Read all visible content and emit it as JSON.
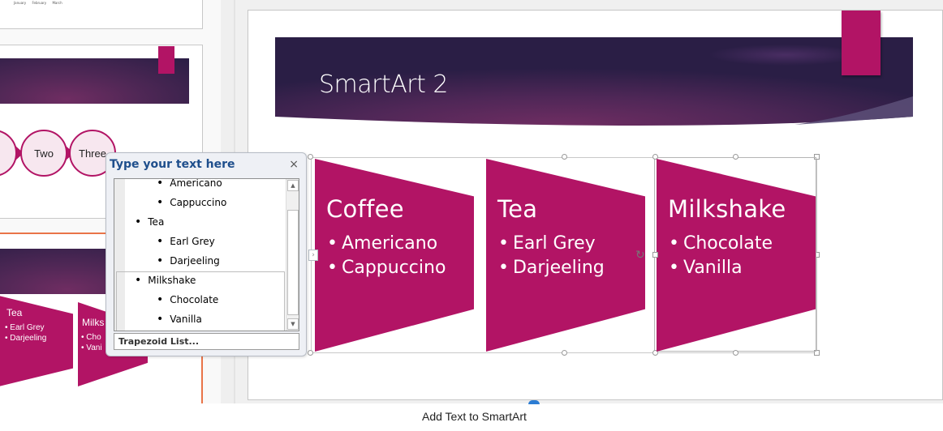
{
  "thumbnails": {
    "slide_prev_legend": [
      "January",
      "February",
      "March"
    ],
    "slide_process": {
      "steps": [
        "Two",
        "Three"
      ]
    },
    "slide_trapezoid": {
      "items": [
        {
          "title": "Tea",
          "bullets": [
            "Earl Grey",
            "Darjeeling"
          ]
        },
        {
          "title": "Milks",
          "bullets": [
            "Cho",
            "Vani"
          ]
        }
      ]
    }
  },
  "slide": {
    "title": "SmartArt 2"
  },
  "smartart": {
    "layout": "Trapezoid List",
    "fill_color": "#b21465",
    "items": [
      {
        "title": "Coffee",
        "bullets": [
          "Americano",
          "Cappuccino"
        ]
      },
      {
        "title": "Tea",
        "bullets": [
          "Earl Grey",
          "Darjeeling"
        ]
      },
      {
        "title": "Milkshake",
        "bullets": [
          "Chocolate",
          "Vanilla"
        ]
      }
    ]
  },
  "text_pane": {
    "title": "Type your text here",
    "close_label": "×",
    "visible_lines": [
      {
        "level": 2,
        "text": "Americano"
      },
      {
        "level": 2,
        "text": "Cappuccino"
      },
      {
        "level": 1,
        "text": "Tea"
      },
      {
        "level": 2,
        "text": "Earl Grey"
      },
      {
        "level": 2,
        "text": "Darjeeling"
      },
      {
        "level": 1,
        "text": "Milkshake"
      },
      {
        "level": 2,
        "text": "Chocolate"
      },
      {
        "level": 2,
        "text": "Vanilla"
      }
    ],
    "layout_link": "Trapezoid List..."
  },
  "caption": "Add Text to SmartArt",
  "colors": {
    "accent": "#b21465",
    "banner_dark": "#2a1e45",
    "banner_mid": "#6f2d62",
    "pane_title": "#1e4e8c",
    "thumbnail_selected": "#e97448"
  }
}
